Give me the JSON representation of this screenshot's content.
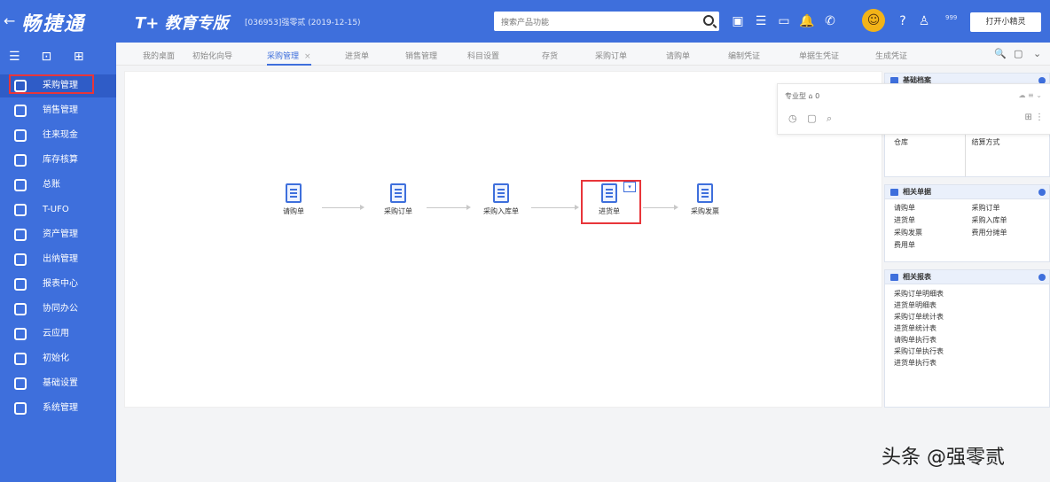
{
  "topbar": {
    "back_icon": "←",
    "brand": "畅捷通",
    "edition": "T+ 教育专版",
    "account": "[036953]强零贰 (2019-12-15)",
    "search_placeholder": "搜索产品功能",
    "badge": "999",
    "open_button": "打开小精灵"
  },
  "sidebar": {
    "tools": [
      "☰",
      "⊡",
      "⊞"
    ],
    "items": [
      {
        "label": "采购管理"
      },
      {
        "label": "销售管理"
      },
      {
        "label": "往来现金"
      },
      {
        "label": "库存核算"
      },
      {
        "label": "总账"
      },
      {
        "label": "T-UFO"
      },
      {
        "label": "资产管理"
      },
      {
        "label": "出纳管理"
      },
      {
        "label": "报表中心"
      },
      {
        "label": "协同办公"
      },
      {
        "label": "云应用"
      },
      {
        "label": "初始化"
      },
      {
        "label": "基础设置"
      },
      {
        "label": "系统管理"
      }
    ]
  },
  "tabs": [
    {
      "label": "我的桌面"
    },
    {
      "label": "初始化向导"
    },
    {
      "label": "采购管理",
      "close": "×"
    },
    {
      "label": "进货单"
    },
    {
      "label": "销售管理"
    },
    {
      "label": "科目设置"
    },
    {
      "label": "存货"
    },
    {
      "label": "采购订单"
    },
    {
      "label": "请购单"
    },
    {
      "label": "编制凭证"
    },
    {
      "label": "单据生凭证"
    },
    {
      "label": "生成凭证"
    }
  ],
  "tab_tools": [
    "🔍",
    "▢",
    "⌄"
  ],
  "flow": {
    "nodes": [
      {
        "label": "请购单"
      },
      {
        "label": "采购订单"
      },
      {
        "label": "采购入库单"
      },
      {
        "label": "进货单"
      },
      {
        "label": "采购发票"
      }
    ],
    "flag": "▾"
  },
  "popover": {
    "title": "专业型 ⌂ 0",
    "right_icons": "☁ ≡ ⌄",
    "tools": "◷ ▢ ⌕",
    "add": "⊞ ⋮"
  },
  "panels": {
    "basic": {
      "title": "基础档案",
      "items": [
        "仓库",
        "结算方式"
      ]
    },
    "docs": {
      "title": "相关单据",
      "items": [
        "请购单",
        "采购订单",
        "进货单",
        "采购入库单",
        "采购发票",
        "费用分摊单",
        "费用单"
      ]
    },
    "reports": {
      "title": "相关报表",
      "items": [
        "采购订单明细表",
        "进货单明细表",
        "采购订单统计表",
        "进货单统计表",
        "请购单执行表",
        "采购订单执行表",
        "进货单执行表"
      ]
    }
  },
  "watermark": "头条 @强零贰",
  "colors": {
    "primary": "#3e6fdc",
    "highlight": "#e8353a",
    "avatar": "#f2b318"
  }
}
